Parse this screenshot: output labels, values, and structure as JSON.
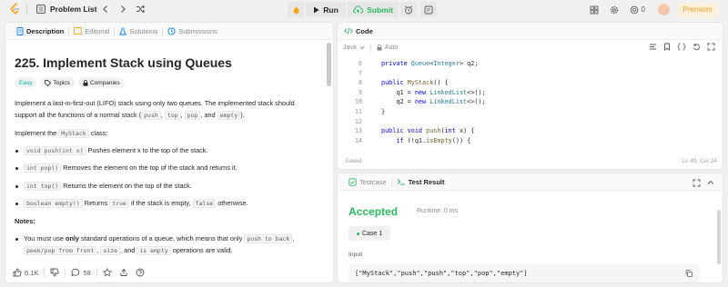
{
  "topbar": {
    "problem_list": "Problem List",
    "run": "Run",
    "submit": "Submit",
    "coins": "0",
    "premium": "Premium"
  },
  "left_tabs": [
    "Description",
    "Editorial",
    "Solutions",
    "Submissions"
  ],
  "problem": {
    "title": "225. Implement Stack using Queues",
    "tags": [
      "Easy",
      "Topics",
      "Companies"
    ],
    "desc_pre": "Implement a last-in-first-out (LIFO) stack using only two queues. The implemented stack should support all the functions of a normal stack (",
    "desc_codes": [
      "push",
      "top",
      "pop",
      "empty"
    ],
    "desc_and": "and",
    "impl_pre": "Implement the ",
    "impl_code": "MyStack",
    "impl_post": " class:",
    "methods": [
      {
        "code": "void push(int x)",
        "text": " Pushes element x to the top of the stack."
      },
      {
        "code": "int pop()",
        "text": " Removes the element on the top of the stack and returns it."
      },
      {
        "code": "int top()",
        "text": " Returns the element on the top of the stack."
      },
      {
        "code": "boolean empty()",
        "text": " Returns ",
        "code2": "true",
        "text2": " if the stack is empty, ",
        "code3": "false",
        "text3": " otherwise."
      }
    ],
    "notes_heading": "Notes:",
    "note1_pre": "You must use ",
    "note1_bold": "only",
    "note1_mid": " standard operations of a queue, which means that only ",
    "note1_codes": [
      "push to back",
      "peek/pop from front",
      "size",
      "is empty"
    ],
    "note1_and": "and",
    "note1_post": "operations are valid."
  },
  "left_bottom": {
    "likes": "6.1K",
    "comments": "58"
  },
  "code_panel": {
    "tab": "Code",
    "language": "Java",
    "auto": "Auto",
    "lines": [
      {
        "n": "6",
        "html": "<span class='kw'>private</span> <span class='ty'>Queue</span>&lt;<span class='ty'>Integer</span>&gt; q2;"
      },
      {
        "n": "7",
        "html": ""
      },
      {
        "n": "8",
        "html": "<span class='kw'>public</span> <span class='fn'>MyStack</span>() {"
      },
      {
        "n": "9",
        "html": "    q1 = <span class='kw'>new</span> <span class='ty'>LinkedList</span>&lt;&gt;();"
      },
      {
        "n": "10",
        "html": "    q2 = <span class='kw'>new</span> <span class='ty'>LinkedList</span>&lt;&gt;();"
      },
      {
        "n": "11",
        "html": "}"
      },
      {
        "n": "12",
        "html": ""
      },
      {
        "n": "13",
        "html": "<span class='kw'>public</span> <span class='kw'>void</span> <span class='fn'>push</span>(<span class='kw'>int</span> x) {"
      },
      {
        "n": "14",
        "html": "    <span class='kw'>if</span> (!q1.<span class='fn'>isEmpty</span>()) {"
      }
    ],
    "saved": "Saved",
    "position": "Ln 49, Col 24"
  },
  "test_panel": {
    "tabs": [
      "Testcase",
      "Test Result"
    ],
    "status": "Accepted",
    "runtime": "Runtime: 0 ms",
    "case": "Case 1",
    "input_label": "Input",
    "input_value": "[\"MyStack\",\"push\",\"push\",\"top\",\"pop\",\"empty\"]"
  },
  "colors": {
    "accent_orange": "#ffa116",
    "accepted_green": "#2cbb5d",
    "tag_easy": "#00af9b"
  }
}
